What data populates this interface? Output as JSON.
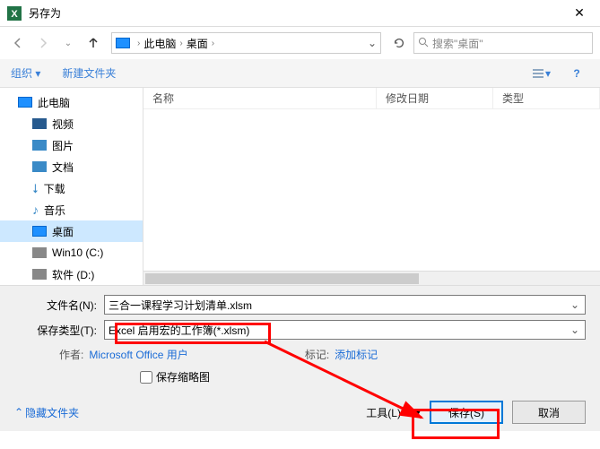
{
  "title": "另存为",
  "nav": {
    "path_root": "此电脑",
    "path_current": "桌面",
    "search_placeholder": "搜索\"桌面\""
  },
  "toolbar": {
    "organize": "组织 ▾",
    "newfolder": "新建文件夹"
  },
  "sidebar": [
    {
      "label": "此电脑",
      "icon": "monitor"
    },
    {
      "label": "视频",
      "icon": "film"
    },
    {
      "label": "图片",
      "icon": "pic"
    },
    {
      "label": "文档",
      "icon": "doc"
    },
    {
      "label": "下载",
      "icon": "down"
    },
    {
      "label": "音乐",
      "icon": "music"
    },
    {
      "label": "桌面",
      "icon": "monitor",
      "active": true
    },
    {
      "label": "Win10 (C:)",
      "icon": "disk"
    },
    {
      "label": "软件 (D:)",
      "icon": "disk"
    }
  ],
  "columns": {
    "name": "名称",
    "date": "修改日期",
    "type": "类型"
  },
  "form": {
    "filename_label": "文件名(N):",
    "filename_value": "三合一课程学习计划清单.xlsm",
    "filetype_label": "保存类型(T):",
    "filetype_value": "Excel 启用宏的工作簿(*.xlsm)",
    "author_key": "作者:",
    "author_val": "Microsoft Office 用户",
    "tags_key": "标记:",
    "tags_val": "添加标记",
    "thumb_label": "保存缩略图"
  },
  "footer": {
    "hide": "隐藏文件夹",
    "tools": "工具(L)",
    "save": "保存(S)",
    "cancel": "取消"
  }
}
